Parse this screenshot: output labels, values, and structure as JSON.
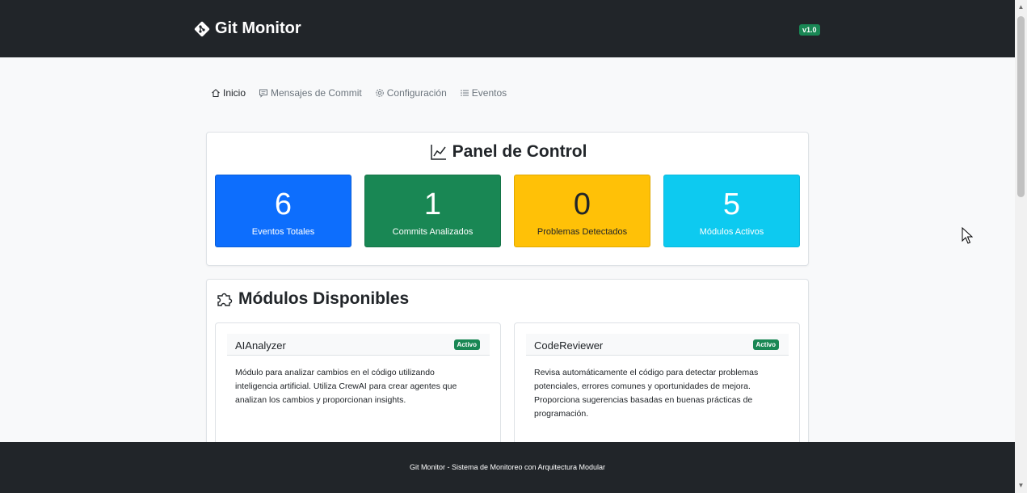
{
  "navbar": {
    "brand": "Git Monitor",
    "version": "v1.0"
  },
  "tabs": [
    {
      "label": "Inicio",
      "icon": "home-icon",
      "active": true
    },
    {
      "label": "Mensajes de Commit",
      "icon": "message-icon",
      "active": false
    },
    {
      "label": "Configuración",
      "icon": "gear-icon",
      "active": false
    },
    {
      "label": "Eventos",
      "icon": "list-icon",
      "active": false
    }
  ],
  "panel": {
    "title": "Panel de Control",
    "icon": "chart-line-icon",
    "stats": [
      {
        "value": "6",
        "label": "Eventos Totales",
        "color": "#0d6efd"
      },
      {
        "value": "1",
        "label": "Commits Analizados",
        "color": "#198754"
      },
      {
        "value": "0",
        "label": "Problemas Detectados",
        "color": "#ffc107"
      },
      {
        "value": "5",
        "label": "Módulos Activos",
        "color": "#0dcaf0"
      }
    ]
  },
  "modules": {
    "title": "Módulos Disponibles",
    "icon": "puzzle-icon",
    "items": [
      {
        "name": "AIAnalyzer",
        "status": "Activo",
        "description": "Módulo para analizar cambios en el código utilizando inteligencia artificial. Utiliza CrewAI para crear agentes que analizan los cambios y proporcionan insights."
      },
      {
        "name": "CodeReviewer",
        "status": "Activo",
        "description": "Revisa automáticamente el código para detectar problemas potenciales, errores comunes y oportunidades de mejora. Proporciona sugerencias basadas en buenas prácticas de programación."
      }
    ]
  },
  "footer": {
    "text": "Git Monitor - Sistema de Monitoreo con Arquitectura Modular"
  }
}
